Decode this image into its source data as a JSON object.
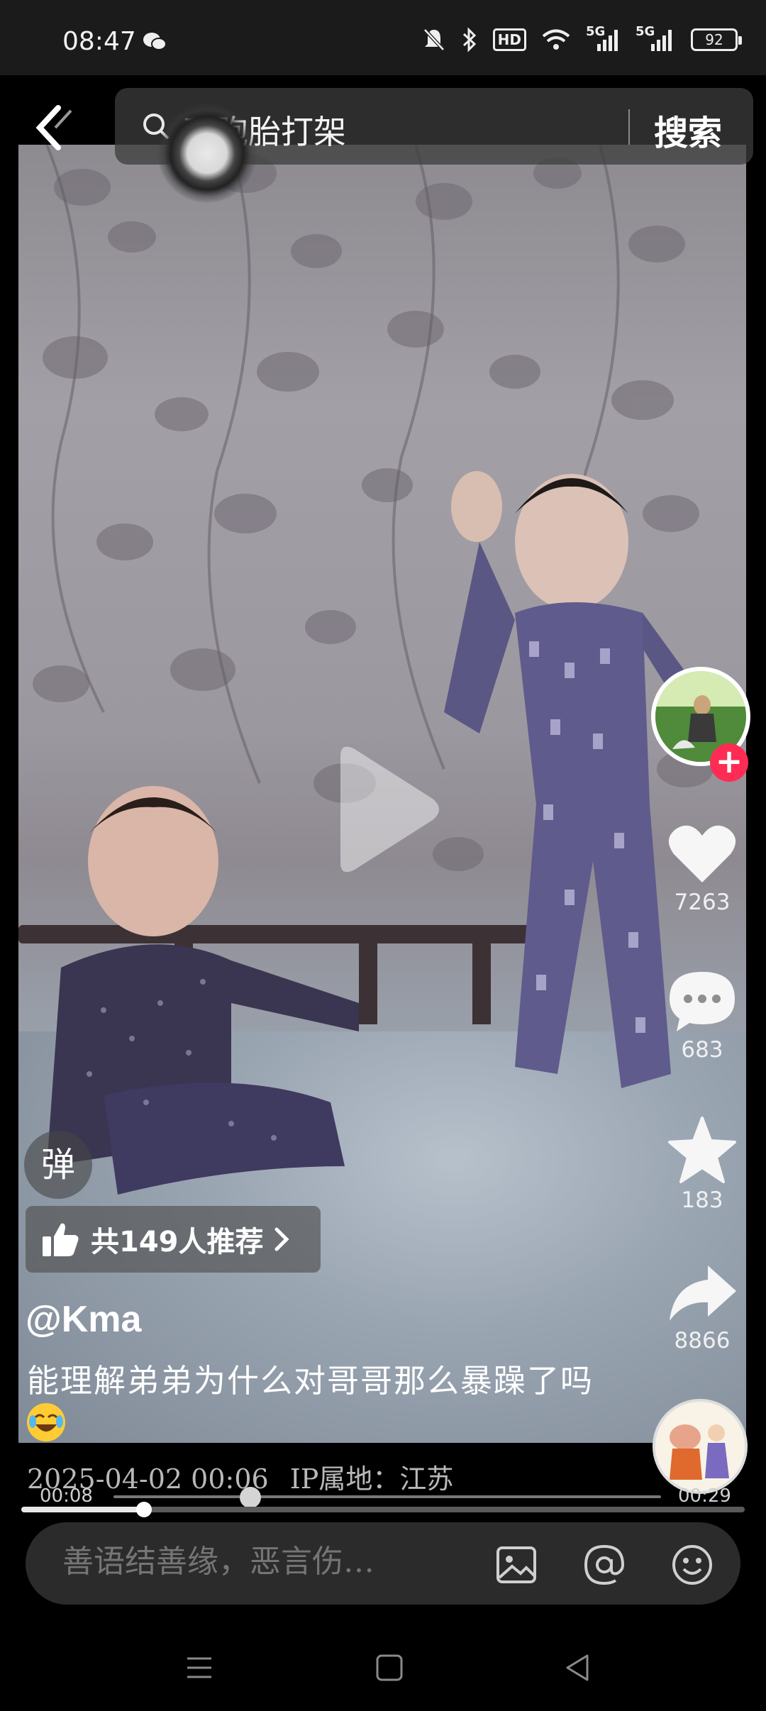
{
  "status_bar": {
    "time": "08:47",
    "network_1": "5G",
    "network_2": "5G",
    "hd_label": "HD",
    "battery": "92"
  },
  "search": {
    "query": "双胞胎打架",
    "button_label": "搜索"
  },
  "video": {
    "author": "@Kma",
    "caption": "能理解弟弟为什么对哥哥那么暴躁了吗",
    "caption_emoji": "laughing-crying-emoji",
    "publish_time": "2025-04-02 00:06",
    "ip_location": "IP属地：江苏",
    "recommend_text": "共149人推荐",
    "danmaku_label": "弹",
    "progress": {
      "current": "00:08",
      "total": "00:29",
      "played_fraction": 0.17,
      "preview_fraction": 0.25
    }
  },
  "actions": {
    "likes": "7263",
    "comments": "683",
    "favorites": "183",
    "shares": "8866"
  },
  "comment_box": {
    "placeholder": "善语结善缘，恶言伤…"
  },
  "colors": {
    "follow_accent": "#fe2c55",
    "background": "#000000"
  },
  "icons": [
    "back-icon",
    "search-icon",
    "play-icon",
    "like-icon",
    "comment-icon",
    "favorite-icon",
    "share-icon",
    "thumbs-up-icon",
    "image-icon",
    "mention-icon",
    "emoji-icon",
    "nav-menu-icon",
    "nav-home-icon",
    "nav-back-icon"
  ]
}
